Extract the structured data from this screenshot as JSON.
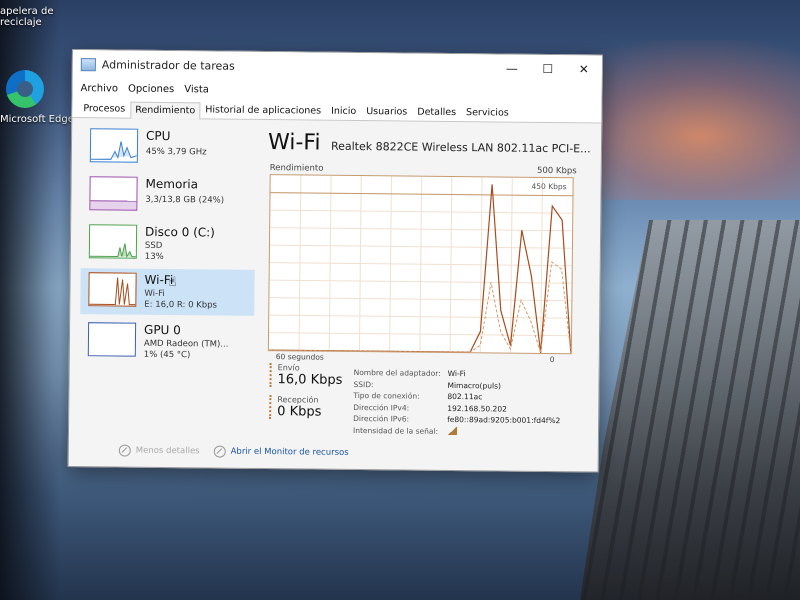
{
  "desktop": {
    "recycle_line1": "apelera de",
    "recycle_line2": "reciclaje",
    "edge_label": "Microsoft Edge"
  },
  "window": {
    "title": "Administrador de tareas",
    "controls": {
      "minimize": "—",
      "maximize": "☐",
      "close": "✕"
    }
  },
  "menu": [
    "Archivo",
    "Opciones",
    "Vista"
  ],
  "tabs": [
    "Procesos",
    "Rendimiento",
    "Historial de aplicaciones",
    "Inicio",
    "Usuarios",
    "Detalles",
    "Servicios"
  ],
  "active_tab": "Rendimiento",
  "sidebar": [
    {
      "name": "CPU",
      "detail1": "45% 3,79 GHz",
      "color": "#3a7fd0"
    },
    {
      "name": "Memoria",
      "detail1": "3,3/13,8 GB (24%)",
      "color": "#9b4fae"
    },
    {
      "name": "Disco 0 (C:)",
      "detail1": "SSD",
      "detail2": "13%",
      "color": "#4fa04f"
    },
    {
      "name": "Wi-Fi",
      "detail1": "Wi-Fi",
      "detail2": "E: 16,0 R: 0 Kbps",
      "color": "#a84c1e",
      "selected": true
    },
    {
      "name": "GPU 0",
      "detail1": "AMD Radeon (TM)...",
      "detail2": "1% (45 °C)",
      "color": "#3a5fb0"
    }
  ],
  "main": {
    "title": "Wi-Fi",
    "adapter": "Realtek 8822CE Wireless LAN 802.11ac PCI-E...",
    "graph_label": "Rendimiento",
    "max_label": "500 Kbps",
    "secondary_max": "450 Kbps",
    "time_label": "60 segundos",
    "zero_label": "0"
  },
  "chart_data": {
    "type": "line",
    "title": "",
    "ylim": [
      0,
      500
    ],
    "x": [
      0,
      40,
      42,
      44,
      46,
      48,
      50,
      52,
      54,
      56,
      58,
      60
    ],
    "series": [
      {
        "values": [
          0,
          0,
          60,
          480,
          120,
          20,
          350,
          220,
          0,
          420,
          380,
          0
        ]
      },
      {
        "values": [
          0,
          0,
          20,
          200,
          60,
          10,
          150,
          90,
          0,
          260,
          240,
          0
        ]
      }
    ]
  },
  "stats": {
    "send_label": "Envío",
    "send_value": "16,0 Kbps",
    "recv_label": "Recepción",
    "recv_value": "0 Kbps"
  },
  "properties": [
    {
      "key": "Nombre del adaptador:",
      "value": "Wi-Fi"
    },
    {
      "key": "SSID:",
      "value": "Mimacro(puls)"
    },
    {
      "key": "Tipo de conexión:",
      "value": "802.11ac"
    },
    {
      "key": "Dirección IPv4:",
      "value": "192.168.50.202"
    },
    {
      "key": "Dirección IPv6:",
      "value": "fe80::89ad:9205:b001:fd4f%2"
    },
    {
      "key": "Intensidad de la señal:",
      "value": ""
    }
  ],
  "footer": {
    "less_details": "Menos detalles",
    "resource_monitor": "Abrir el Monitor de recursos"
  }
}
